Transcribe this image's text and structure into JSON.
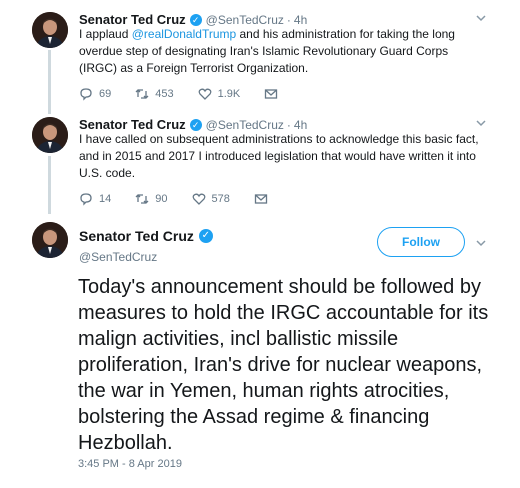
{
  "tweets": [
    {
      "name": "Senator Ted Cruz",
      "handle": "@SenTedCruz",
      "separator": "·",
      "time": "4h",
      "text_before": "I applaud ",
      "mention": "@realDonaldTrump",
      "text_after": " and his administration for taking the long overdue step of designating Iran's Islamic Revolutionary Guard Corps (IRGC) as a Foreign Terrorist Organization.",
      "replies": "69",
      "retweets": "453",
      "likes": "1.9K"
    },
    {
      "name": "Senator Ted Cruz",
      "handle": "@SenTedCruz",
      "separator": "·",
      "time": "4h",
      "text": "I have called on subsequent administrations to acknowledge this basic fact, and in 2015 and 2017 I introduced legislation that would have written it into U.S. code.",
      "replies": "14",
      "retweets": "90",
      "likes": "578"
    }
  ],
  "main_tweet": {
    "name": "Senator Ted Cruz",
    "handle": "@SenTedCruz",
    "follow_label": "Follow",
    "text": "Today's announcement should be followed by measures to hold the IRGC accountable for its malign activities, incl ballistic missile proliferation, Iran's drive for nuclear weapons, the war in Yemen, human rights atrocities, bolstering the Assad regime & financing Hezbollah.",
    "timestamp": "3:45 PM - 8 Apr 2019"
  },
  "colors": {
    "accent": "#1da1f2",
    "link": "#1b95e0",
    "muted": "#657786",
    "thread_line": "#cfd9de"
  },
  "icons": {
    "verified": "verified-badge-icon",
    "reply": "reply-icon",
    "retweet": "retweet-icon",
    "like": "heart-icon",
    "dm": "envelope-icon",
    "more": "chevron-down-icon"
  }
}
